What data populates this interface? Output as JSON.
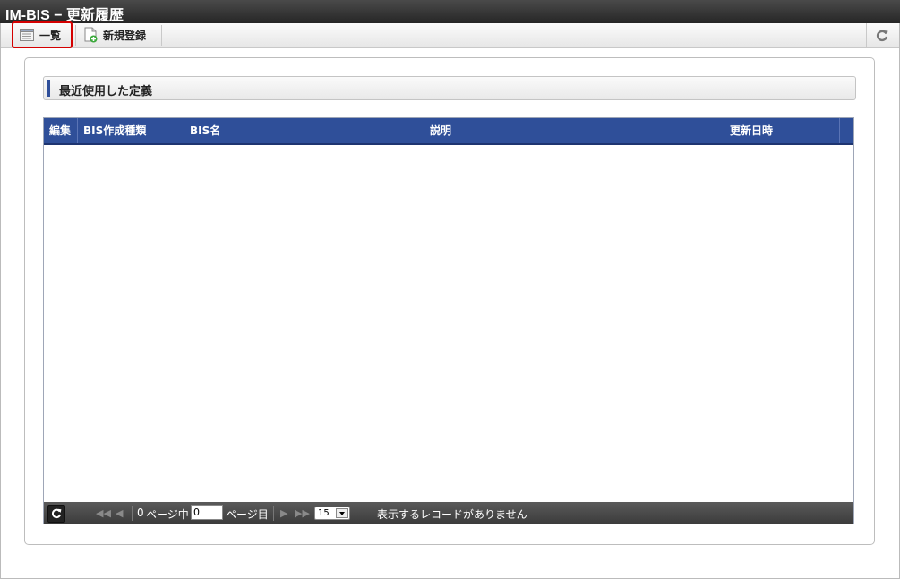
{
  "window": {
    "title": "IM-BIS − 更新履歴"
  },
  "toolbar": {
    "list_label": "一覧",
    "new_label": "新規登録"
  },
  "section": {
    "title": "最近使用した定義"
  },
  "table": {
    "columns": [
      "編集",
      "BIS作成種類",
      "BIS名",
      "説明",
      "更新日時"
    ],
    "rows": []
  },
  "pager": {
    "total_pages": "0",
    "page_of_label": "ページ中",
    "page_suffix_label": "ページ目",
    "current_page": "0",
    "page_size": "15",
    "status": "表示するレコードがありません"
  },
  "colors": {
    "header_blue": "#2f4f99",
    "highlight_red": "#d40000"
  }
}
